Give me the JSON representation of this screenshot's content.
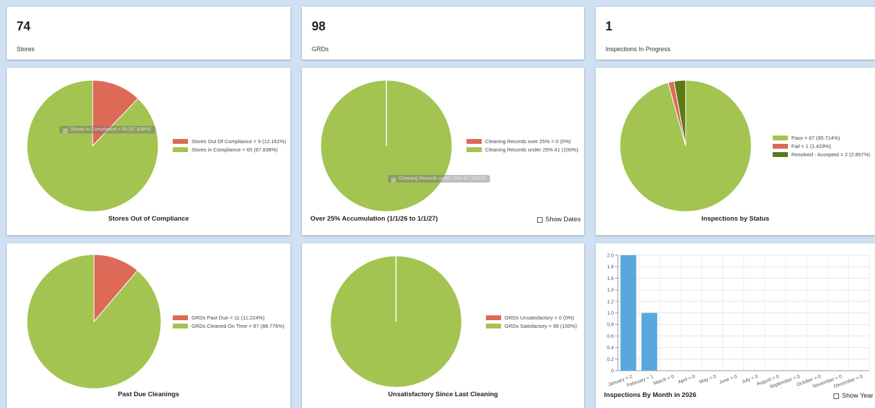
{
  "stats": [
    {
      "value": "74",
      "label": "Stores"
    },
    {
      "value": "98",
      "label": "GRDs"
    },
    {
      "value": "1",
      "label": "Inspections In Progress"
    }
  ],
  "colors": {
    "red": "#dc6a57",
    "green": "#a3c451",
    "darkgreen": "#5a7a16",
    "blue": "#5aa7dd"
  },
  "controls": {
    "show_dates": "Show Dates",
    "show_year": "Show Year"
  },
  "chart_data": [
    {
      "type": "pie",
      "title": "Stores Out of Compliance",
      "tooltip": "Stores in Compliance = 65 (87.838%)",
      "slices": [
        {
          "label": "Stores Out Of Compliance = 9 (12.162%)",
          "value": 9,
          "color": "#dc6a57"
        },
        {
          "label": "Stores in Compliance = 65 (87.838%)",
          "value": 65,
          "color": "#a3c451"
        }
      ]
    },
    {
      "type": "pie",
      "title": "Over 25% Accumulation (1/1/26 to 1/1/27)",
      "tooltip": "Cleaning Records under 25% 41 (100%)",
      "slices": [
        {
          "label": "Cleaning Records over 25% = 0 (0%)",
          "value": 0,
          "color": "#dc6a57"
        },
        {
          "label": "Cleaning Records under 25% 41 (100%)",
          "value": 41,
          "color": "#a3c451"
        }
      ]
    },
    {
      "type": "pie",
      "title": "Inspections by Status",
      "slices": [
        {
          "label": "Pass = 67 (95.714%)",
          "value": 67,
          "color": "#a3c451"
        },
        {
          "label": "Fail = 1 (1.429%)",
          "value": 1,
          "color": "#dc6a57"
        },
        {
          "label": "Resolved - Accepted = 2 (2.857%)",
          "value": 2,
          "color": "#5a7a16"
        }
      ]
    },
    {
      "type": "pie",
      "title": "Past Due Cleanings",
      "slices": [
        {
          "label": "GRDs Past Due = 11 (11.224%)",
          "value": 11,
          "color": "#dc6a57"
        },
        {
          "label": "GRDs Cleaned On Time = 87 (88.776%)",
          "value": 87,
          "color": "#a3c451"
        }
      ]
    },
    {
      "type": "pie",
      "title": "Unsatisfactory Since Last Cleaning",
      "slices": [
        {
          "label": "GRDs Unsatisfactory = 0 (0%)",
          "value": 0,
          "color": "#dc6a57"
        },
        {
          "label": "GRDs Satisfactory = 98 (100%)",
          "value": 98,
          "color": "#a3c451"
        }
      ]
    },
    {
      "type": "bar",
      "title": "Inspections By Month in 2026",
      "categories": [
        "January = 2",
        "February = 1",
        "March = 0",
        "April = 0",
        "May = 0",
        "June = 0",
        "July = 0",
        "August = 0",
        "September = 0",
        "October = 0",
        "November = 0",
        "December = 0"
      ],
      "values": [
        2,
        1,
        0,
        0,
        0,
        0,
        0,
        0,
        0,
        0,
        0,
        0
      ],
      "ylim": [
        0,
        2.0
      ],
      "yticks": [
        "0",
        "0.2",
        "0.4",
        "0.6",
        "0.8",
        "1.0",
        "1.2",
        "1.4",
        "1.6",
        "1.8",
        "2.0"
      ],
      "color": "#5aa7dd",
      "grid": true
    }
  ]
}
